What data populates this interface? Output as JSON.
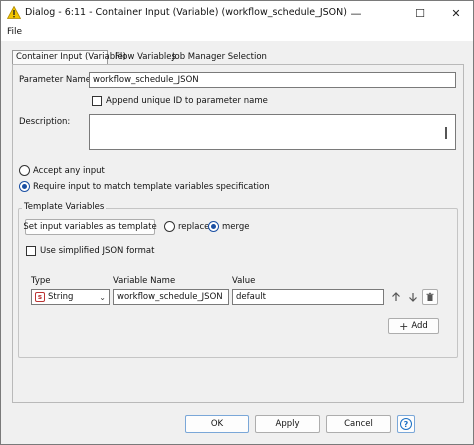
{
  "window": {
    "title": "Dialog - 6:11 - Container Input (Variable) (workflow_schedule_JSON)",
    "minimize_glyph": "—",
    "maximize_glyph": "☐",
    "close_glyph": "✕"
  },
  "menu": {
    "file": "File"
  },
  "tabs": [
    {
      "label": "Container Input (Variable)"
    },
    {
      "label": "Flow Variables"
    },
    {
      "label": "Job Manager Selection"
    }
  ],
  "form": {
    "parameter_name_label": "Parameter Name:",
    "parameter_name_value": "workflow_schedule_JSON",
    "append_unique_label": "Append unique ID to parameter name",
    "description_label": "Description:",
    "description_value": "",
    "accept_any_label": "Accept any input",
    "require_match_label": "Require input to match template variables specification"
  },
  "template": {
    "group_title": "Template Variables",
    "set_input_button": "Set input variables as template",
    "replace_label": "replace",
    "merge_label": "merge",
    "simplified_json_label": "Use simplified JSON format",
    "col_type": "Type",
    "col_name": "Variable Name",
    "col_value": "Value",
    "row": {
      "type_badge": "s",
      "type": "String",
      "name": "workflow_schedule_JSON",
      "value": "default"
    },
    "add_button": "Add"
  },
  "footer": {
    "ok": "OK",
    "apply": "Apply",
    "cancel": "Cancel",
    "help_glyph": "?"
  },
  "colors": {
    "accent": "#1a4fa3",
    "warning": "#f2c500"
  }
}
